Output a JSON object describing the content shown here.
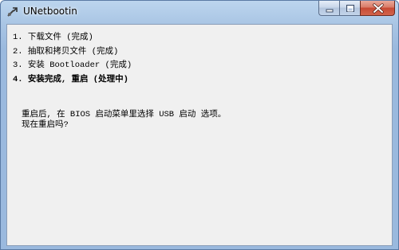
{
  "window": {
    "title": "UNetbootin",
    "icon": "unetbootin-app-icon"
  },
  "caption_buttons": {
    "minimize_icon": "minimize-icon",
    "maximize_icon": "maximize-icon",
    "close_icon": "close-icon"
  },
  "steps": [
    {
      "label": "1. 下载文件 (完成)",
      "state": "done"
    },
    {
      "label": "2. 抽取和拷贝文件 (完成)",
      "state": "done"
    },
    {
      "label": "3. 安装 Bootloader (完成)",
      "state": "done"
    },
    {
      "label": "4. 安装完成, 重启 (处理中)",
      "state": "active"
    }
  ],
  "message": {
    "line1": "重启后, 在 BIOS 启动菜单里选择 USB 启动 选项。",
    "line2": "现在重启吗?"
  },
  "colors": {
    "titlebar": "#a9c5e4",
    "client_bg": "#f0f0f0",
    "close_button": "#c74a34"
  }
}
